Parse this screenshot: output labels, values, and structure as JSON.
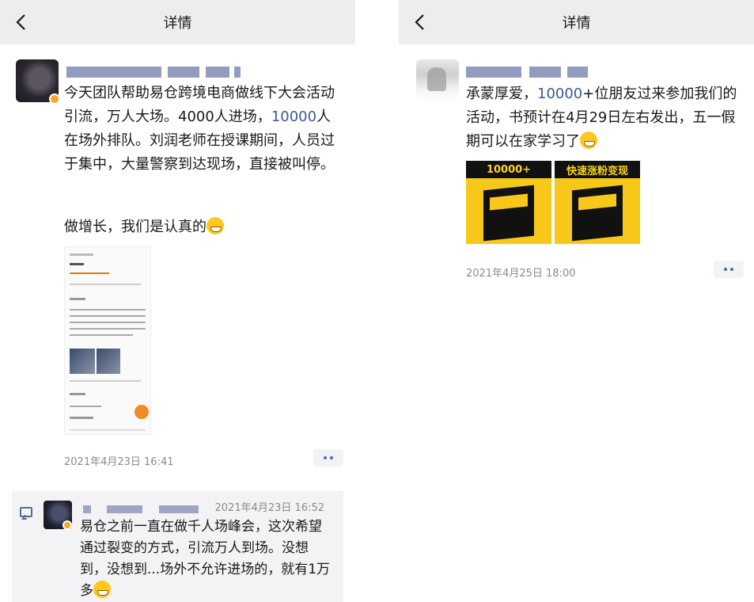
{
  "left_panel": {
    "header": {
      "title": "详情",
      "back_icon": "chevron-left-icon"
    },
    "post": {
      "text_before_highlight": "今天团队帮助易仓跨境电商做线下大会活动引流，万人大场。4000人进场，",
      "highlight": "10000",
      "text_after_highlight": "人在场外排队。刘润老师在授课期间，人员过于集中，大量警察到达现场，直接被叫停。",
      "text_second_paragraph": "做增长，我们是认真的",
      "emoji": "grinning-face-emoji",
      "timestamp": "2021年4月23日 16:41"
    },
    "comment": {
      "timestamp": "2021年4月23日 16:52",
      "text": "易仓之前一直在做千人场峰会，这次希望通过裂变的方式，引流万人到场。没想到，没想到...场外不允许进场的，就有1万多",
      "emoji": "tears-of-joy-emoji"
    }
  },
  "right_panel": {
    "header": {
      "title": "详情",
      "back_icon": "chevron-left-icon"
    },
    "post": {
      "text_before_highlight": "承蒙厚爱，",
      "highlight": "10000",
      "text_after_highlight": "+位朋友过来参加我们的活动，书预计在4月29日左右发出，五一假期可以在家学习了",
      "emoji": "thinking-face-emoji",
      "book_images": [
        {
          "headline": "10000+"
        },
        {
          "headline": "快速涨粉变现"
        }
      ],
      "timestamp": "2021年4月25日 18:00"
    }
  },
  "colors": {
    "link": "#3c5a96",
    "header_bg": "#ededed",
    "timestamp": "#8a8a8a",
    "book_yellow": "#f7c81a"
  }
}
